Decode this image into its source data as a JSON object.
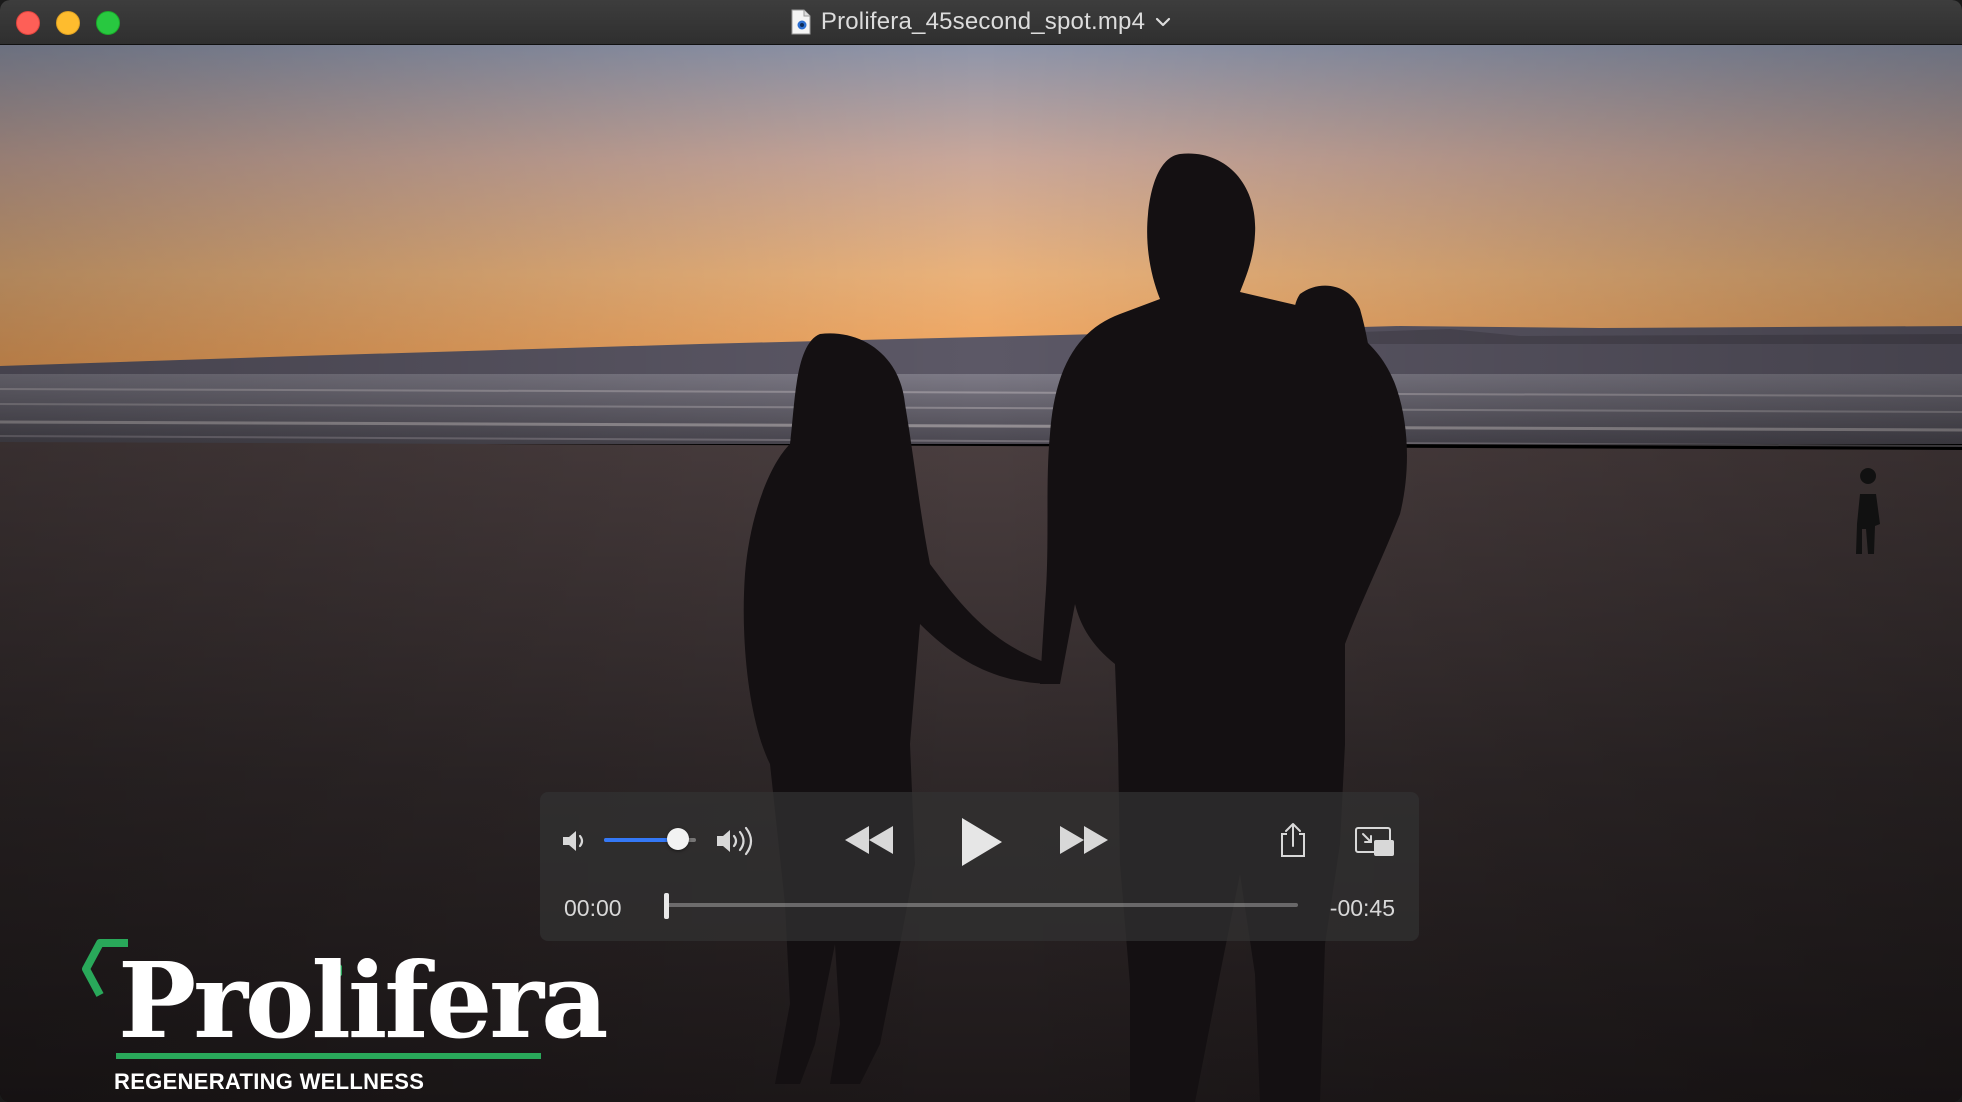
{
  "window": {
    "title": "Prolifera_45second_spot.mp4"
  },
  "player": {
    "volume_level": 0.8,
    "playback_progress": 0.0,
    "current_time": "00:00",
    "remaining_time": "-00:45"
  },
  "overlay": {
    "brand_name": "Prolifera",
    "tagline": "REGENERATING WELLNESS"
  },
  "colors": {
    "accent": "#3478f6",
    "brand_green": "#29a85a",
    "close": "#fe5f57",
    "minimize": "#febc2e",
    "maximize": "#28c840"
  },
  "icons": {
    "close": "close-button",
    "minimize": "minimize-button",
    "maximize": "maximize-button",
    "document": "document-icon",
    "chevron": "chevron-down-icon",
    "volume_low": "volume-low-icon",
    "volume_high": "volume-high-icon",
    "rewind": "rewind-icon",
    "play": "play-icon",
    "fast_forward": "fast-forward-icon",
    "share": "share-icon",
    "pip": "picture-in-picture-icon"
  }
}
